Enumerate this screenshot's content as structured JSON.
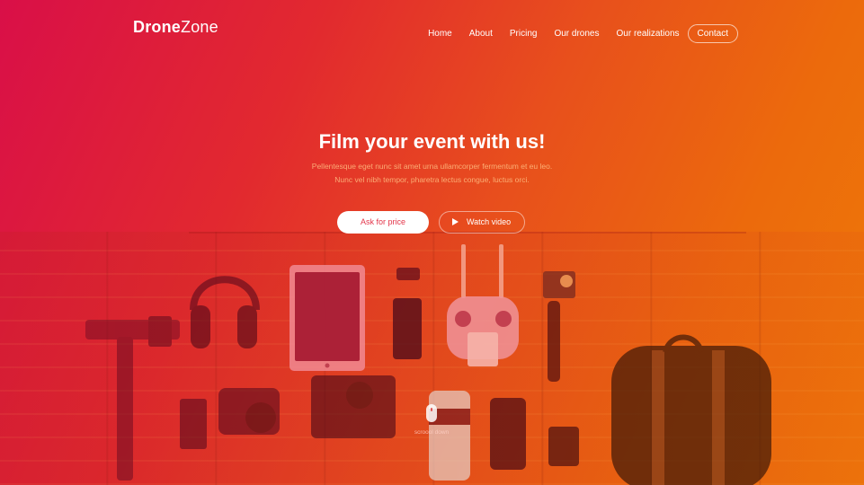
{
  "brand": {
    "bold": "Drone",
    "light": "Zone"
  },
  "nav": {
    "items": [
      "Home",
      "About",
      "Pricing",
      "Our drones",
      "Our realizations"
    ],
    "contact": "Contact"
  },
  "hero": {
    "title": "Film your event with us!",
    "subtitle_line1": "Pellentesque eget nunc sit amet urna ullamcorper fermentum et eu leo.",
    "subtitle_line2": "Nunc vel nibh tempor, pharetra lectus congue, luctus orci.",
    "ask_label": "Ask for price",
    "watch_label": "Watch video"
  },
  "scroll": {
    "label": "scroool down"
  },
  "colors": {
    "gradient_start": "#d90f48",
    "gradient_end": "#ee7a08",
    "ask_text": "#e3354a"
  },
  "icons": {
    "watch": "play-icon",
    "scroll": "mouse-icon"
  }
}
